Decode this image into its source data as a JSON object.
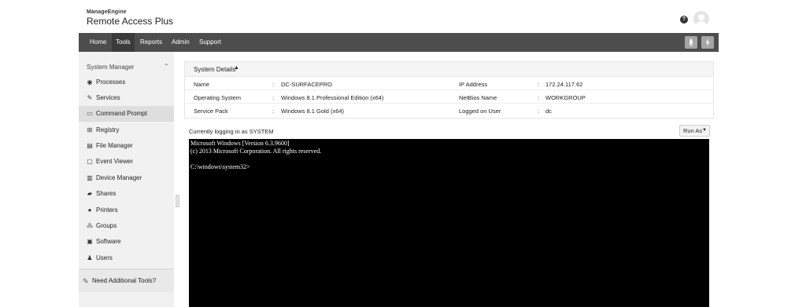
{
  "header": {
    "brand_top": "ManageEngine",
    "brand_bottom": "Remote Access Plus",
    "help_icon": "?"
  },
  "nav": {
    "items": [
      "Home",
      "Tools",
      "Reports",
      "Admin",
      "Support"
    ],
    "active": "Tools",
    "right_icons": [
      "rocket-icon",
      "lightning-icon"
    ]
  },
  "sidebar": {
    "section_title": "System Manager",
    "items": [
      {
        "label": "Processes",
        "icon": "process-icon"
      },
      {
        "label": "Services",
        "icon": "services-icon"
      },
      {
        "label": "Command Prompt",
        "icon": "command-prompt-icon"
      },
      {
        "label": "Registry",
        "icon": "registry-icon"
      },
      {
        "label": "File Manager",
        "icon": "file-manager-icon"
      },
      {
        "label": "Event Viewer",
        "icon": "event-viewer-icon"
      },
      {
        "label": "Device Manager",
        "icon": "device-manager-icon"
      },
      {
        "label": "Shares",
        "icon": "shares-icon"
      },
      {
        "label": "Printers",
        "icon": "printer-icon"
      },
      {
        "label": "Groups",
        "icon": "groups-icon"
      },
      {
        "label": "Software",
        "icon": "software-icon"
      },
      {
        "label": "Users",
        "icon": "users-icon"
      }
    ],
    "active_item": "Command Prompt",
    "footer_label": "Need Additional Tools?"
  },
  "system_details": {
    "title": "System Details",
    "rows": [
      {
        "k1": "Name",
        "v1": "DC-SURFACEPRO",
        "k2": "IP Address",
        "v2": "172.24.117.62"
      },
      {
        "k1": "Operating System",
        "v1": "Windows 8.1 Professional Edition (x64)",
        "k2": "NetBios Name",
        "v2": "WORKGROUP"
      },
      {
        "k1": "Service Pack",
        "v1": "Windows 8.1 Gold (x64)",
        "k2": "Logged on User",
        "v2": "dc"
      }
    ],
    "separator": ":"
  },
  "session": {
    "logging_text": "Currently logging in as SYSTEM",
    "run_as_label": "Run As"
  },
  "console": {
    "lines": [
      "Microsoft Windows [Version 6.3.9600]",
      "(c) 2013 Microsoft Corporation. All rights reserved.",
      "",
      "C:\\windows\\system32>"
    ]
  }
}
